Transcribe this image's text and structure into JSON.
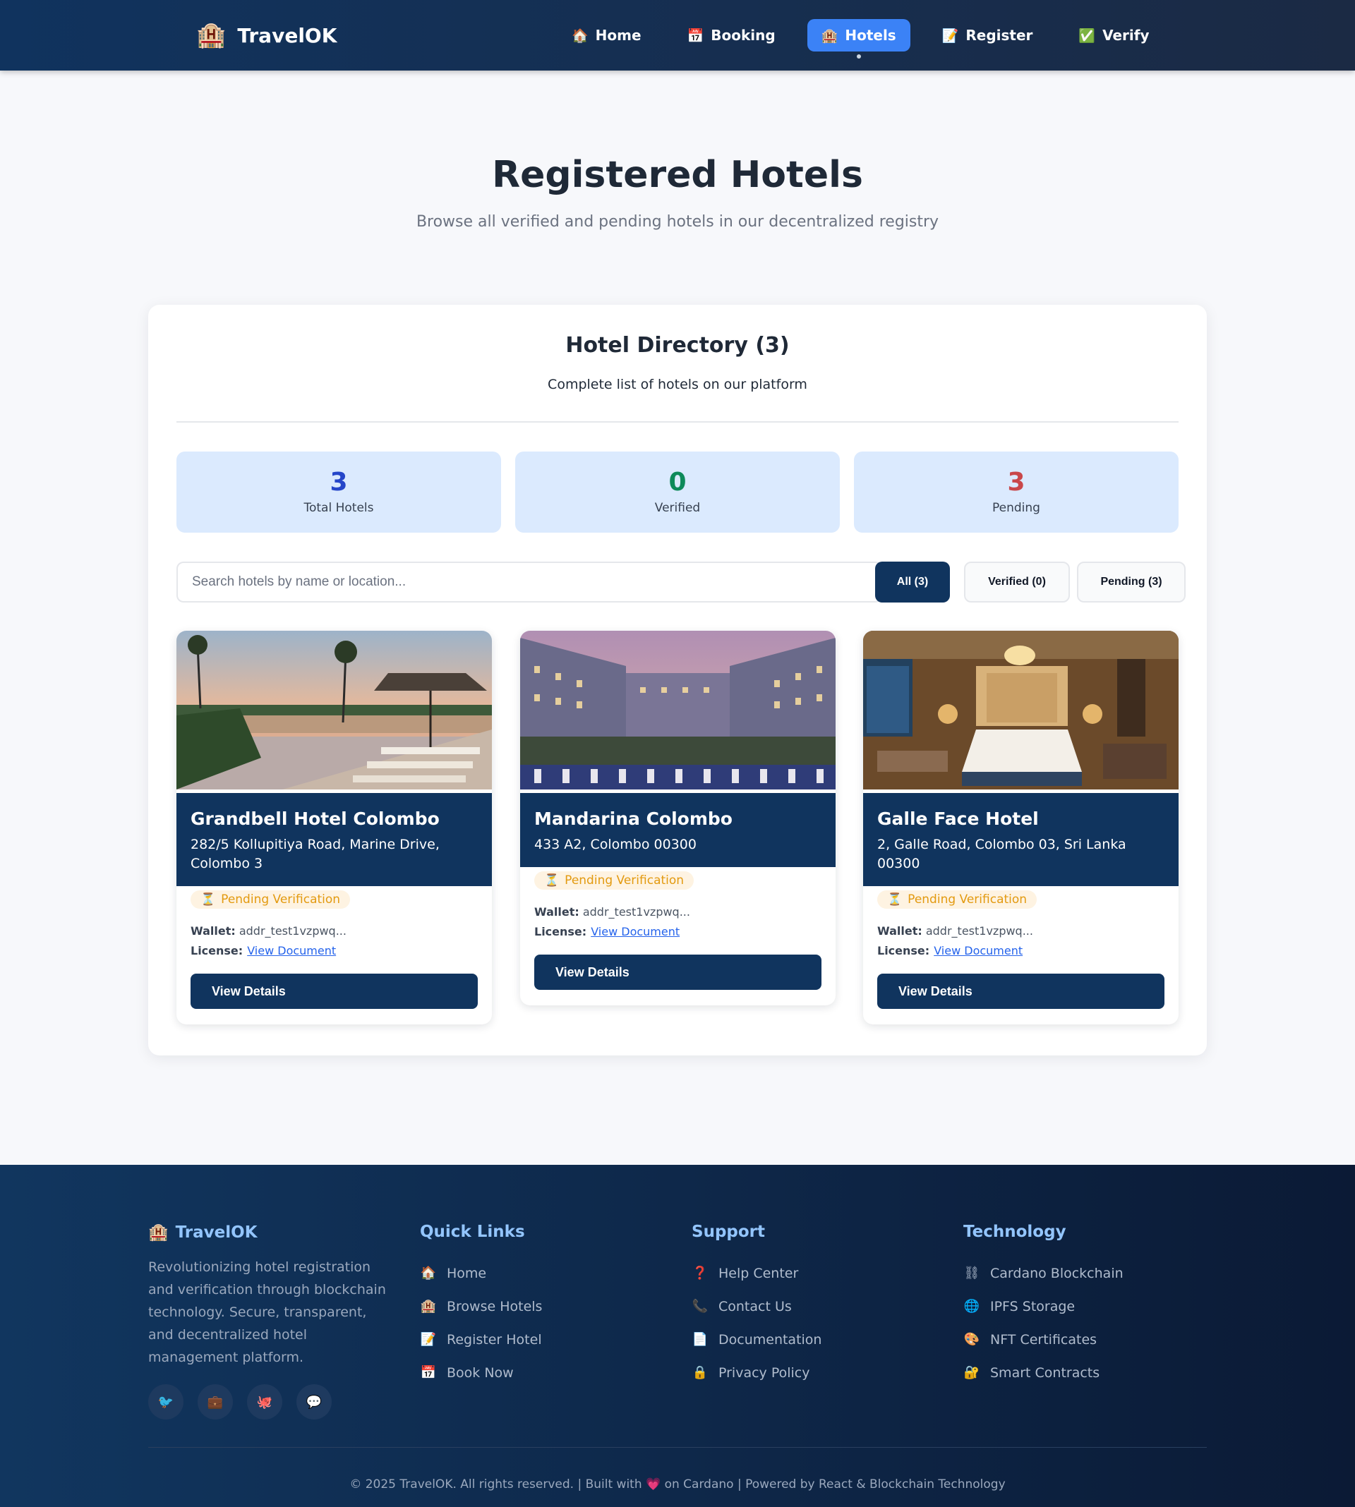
{
  "nav": {
    "brand": {
      "icon": "🏨",
      "name": "TravelOK"
    },
    "links": [
      {
        "icon": "🏠",
        "label": "Home",
        "active": false
      },
      {
        "icon": "📅",
        "label": "Booking",
        "active": false
      },
      {
        "icon": "🏨",
        "label": "Hotels",
        "active": true
      },
      {
        "icon": "📝",
        "label": "Register",
        "active": false
      },
      {
        "icon": "✅",
        "label": "Verify",
        "active": false
      }
    ]
  },
  "hero": {
    "title": "Registered Hotels",
    "subtitle": "Browse all verified and pending hotels in our decentralized registry"
  },
  "directory": {
    "title": "Hotel Directory (3)",
    "subtitle": "Complete list of hotels on our platform",
    "stats": [
      {
        "value": "3",
        "label": "Total Hotels",
        "color": "#2546c9"
      },
      {
        "value": "0",
        "label": "Verified",
        "color": "#0e8a5a"
      },
      {
        "value": "3",
        "label": "Pending",
        "color": "#c9474a"
      }
    ],
    "search_placeholder": "Search hotels by name or location...",
    "filters": {
      "all": "All (3)",
      "verified": "Verified (0)",
      "pending": "Pending (3)"
    },
    "hotels": [
      {
        "name": "Grandbell Hotel Colombo",
        "address": "282/5 Kollupitiya Road, Marine Drive, Colombo 3",
        "status": "Pending Verification",
        "status_icon": "⏳",
        "wallet_label": "Wallet:",
        "wallet": "addr_test1vzpwq...",
        "license_label": "License:",
        "license_link": "View Document",
        "button": "View Details",
        "image": "pool-sunset"
      },
      {
        "name": "Mandarina Colombo",
        "address": "433 A2, Colombo 00300",
        "status": "Pending Verification",
        "status_icon": "⏳",
        "wallet_label": "Wallet:",
        "wallet": "addr_test1vzpwq...",
        "license_label": "License:",
        "license_link": "View Document",
        "button": "View Details",
        "image": "courtyard-dusk"
      },
      {
        "name": "Galle Face Hotel",
        "address": "2, Galle Road, Colombo 03, Sri Lanka 00300",
        "status": "Pending Verification",
        "status_icon": "⏳",
        "wallet_label": "Wallet:",
        "wallet": "addr_test1vzpwq...",
        "license_label": "License:",
        "license_link": "View Document",
        "button": "View Details",
        "image": "bedroom"
      }
    ]
  },
  "footer": {
    "brand": {
      "icon": "🏨",
      "name": "TravelOK"
    },
    "about": "Revolutionizing hotel registration and verification through blockchain technology. Secure, transparent, and decentralized hotel management platform.",
    "socials": [
      {
        "icon": "🐦",
        "name": "twitter-icon"
      },
      {
        "icon": "💼",
        "name": "linkedin-icon"
      },
      {
        "icon": "🐙",
        "name": "github-icon"
      },
      {
        "icon": "💬",
        "name": "chat-icon"
      }
    ],
    "columns": [
      {
        "title": "Quick Links",
        "items": [
          {
            "icon": "🏠",
            "label": "Home"
          },
          {
            "icon": "🏨",
            "label": "Browse Hotels"
          },
          {
            "icon": "📝",
            "label": "Register Hotel"
          },
          {
            "icon": "📅",
            "label": "Book Now"
          }
        ]
      },
      {
        "title": "Support",
        "items": [
          {
            "icon": "❓",
            "label": "Help Center"
          },
          {
            "icon": "📞",
            "label": "Contact Us"
          },
          {
            "icon": "📄",
            "label": "Documentation"
          },
          {
            "icon": "🔒",
            "label": "Privacy Policy"
          }
        ]
      },
      {
        "title": "Technology",
        "items": [
          {
            "icon": "⛓",
            "label": "Cardano Blockchain"
          },
          {
            "icon": "🌐",
            "label": "IPFS Storage"
          },
          {
            "icon": "🎨",
            "label": "NFT Certificates"
          },
          {
            "icon": "🔐",
            "label": "Smart Contracts"
          }
        ]
      }
    ],
    "copyright_before": "© 2025 TravelOK. All rights reserved. | Built with",
    "heart": "💗",
    "copyright_after": "on Cardano | Powered by React & Blockchain Technology"
  }
}
